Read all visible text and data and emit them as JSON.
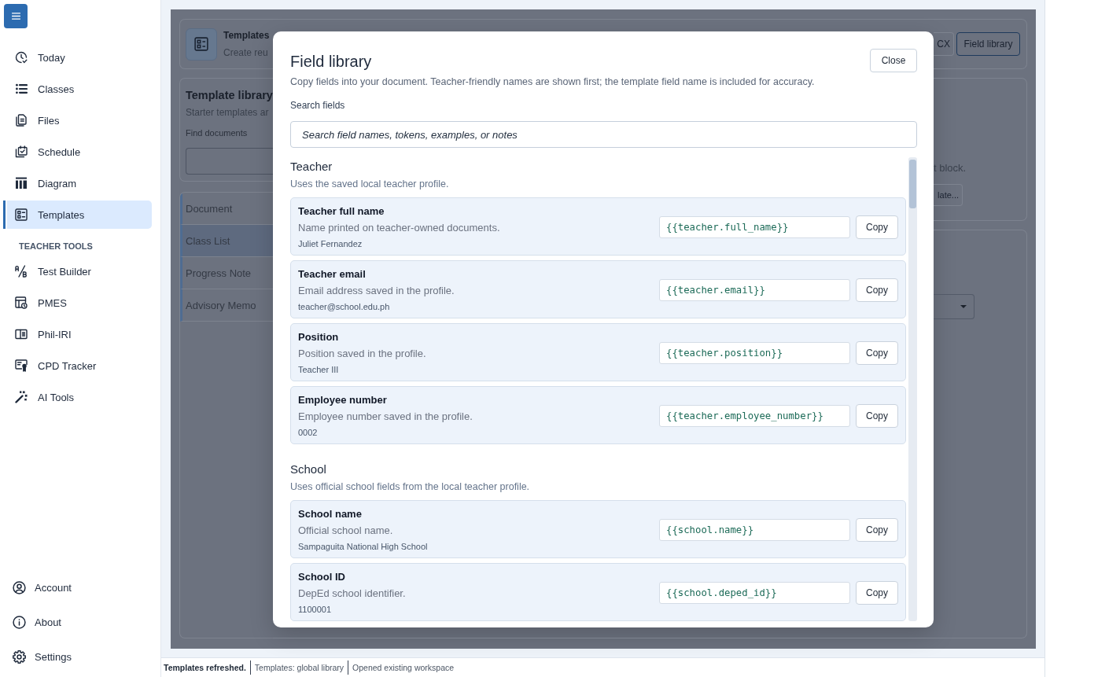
{
  "sidebar": {
    "items": [
      {
        "label": "Today",
        "selected": false
      },
      {
        "label": "Classes",
        "selected": false
      },
      {
        "label": "Files",
        "selected": false
      },
      {
        "label": "Schedule",
        "selected": false
      },
      {
        "label": "Diagram",
        "selected": false
      },
      {
        "label": "Templates",
        "selected": true
      }
    ],
    "section_title": "TEACHER TOOLS",
    "tools": [
      {
        "label": "Test Builder",
        "selected": false
      },
      {
        "label": "PMES",
        "selected": false
      },
      {
        "label": "Phil-IRI",
        "selected": false
      },
      {
        "label": "CPD Tracker",
        "selected": false
      },
      {
        "label": "AI Tools",
        "selected": false
      }
    ],
    "footer": [
      {
        "label": "Account",
        "selected": false
      },
      {
        "label": "About",
        "selected": false
      },
      {
        "label": "Settings",
        "selected": false
      }
    ]
  },
  "page_header": {
    "title": "Templates",
    "subtitle": "Create reu",
    "actions": [
      "CX",
      "Field library"
    ]
  },
  "library": {
    "title": "Template library",
    "subtitle": "Starter templates ar",
    "search_label": "Find documents",
    "templates": [
      {
        "label": "Document",
        "selected": false
      },
      {
        "label": "Class List",
        "selected": true
      },
      {
        "label": "Progress Note",
        "selected": false
      },
      {
        "label": "Advisory Memo",
        "selected": false
      }
    ]
  },
  "editor": {
    "note": "t block.",
    "action": "late..."
  },
  "dialog": {
    "title": "Field library",
    "description": "Copy fields into your document. Teacher-friendly names are shown first; the template field name is included for accuracy.",
    "close_label": "Close",
    "search_label": "Search fields",
    "search": {
      "placeholder": "Search field names, tokens, examples, or notes"
    },
    "groups": [
      {
        "title": "Teacher",
        "description": "Uses the saved local teacher profile.",
        "fields": [
          {
            "name": "Teacher full name",
            "description": "Name printed on teacher-owned documents.",
            "example": "Juliet Fernandez",
            "token": "{{teacher.full_name}}",
            "copy_label": "Copy"
          },
          {
            "name": "Teacher email",
            "description": "Email address saved in the profile.",
            "example": "teacher@school.edu.ph",
            "token": "{{teacher.email}}",
            "copy_label": "Copy"
          },
          {
            "name": "Position",
            "description": "Position saved in the profile.",
            "example": "Teacher III",
            "token": "{{teacher.position}}",
            "copy_label": "Copy"
          },
          {
            "name": "Employee number",
            "description": "Employee number saved in the profile.",
            "example": "0002",
            "token": "{{teacher.employee_number}}",
            "copy_label": "Copy"
          }
        ]
      },
      {
        "title": "School",
        "description": "Uses official school fields from the local teacher profile.",
        "fields": [
          {
            "name": "School name",
            "description": "Official school name.",
            "example": "Sampaguita National High School",
            "token": "{{school.name}}",
            "copy_label": "Copy"
          },
          {
            "name": "School ID",
            "description": "DepEd school identifier.",
            "example": "1100001",
            "token": "{{school.deped_id}}",
            "copy_label": "Copy"
          }
        ]
      }
    ]
  },
  "status_bar": {
    "message": "Templates refreshed.",
    "details": [
      "Templates: global library",
      "Opened existing workspace"
    ]
  }
}
